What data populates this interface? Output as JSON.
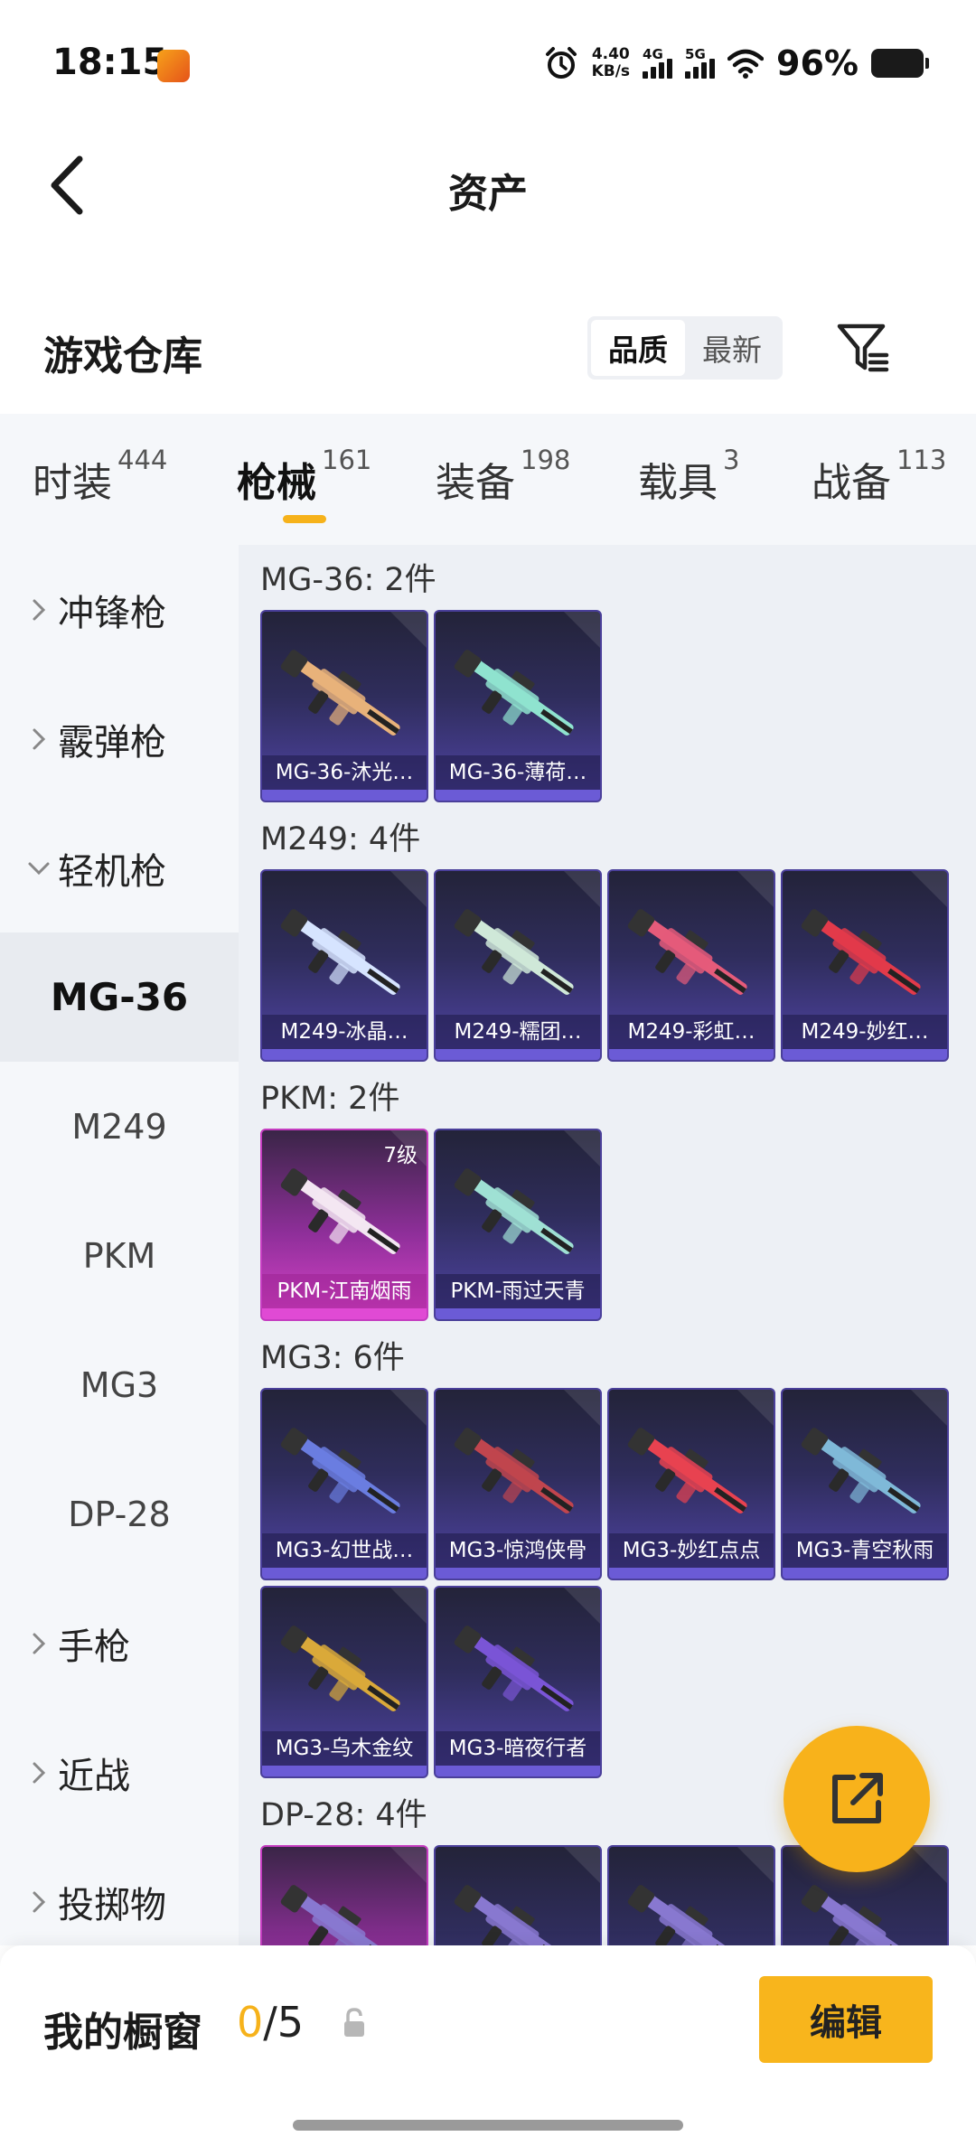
{
  "status": {
    "time": "18:15",
    "net_speed_value": "4.40",
    "net_speed_unit": "KB/s",
    "sim1": "4G",
    "sim2": "5G",
    "battery": "96%"
  },
  "header": {
    "title": "资产"
  },
  "warehouse": {
    "title": "游戏仓库",
    "sort_options": [
      "品质",
      "最新"
    ],
    "active_sort": "品质"
  },
  "tabs": [
    {
      "label": "时装",
      "count": "444"
    },
    {
      "label": "枪械",
      "count": "161"
    },
    {
      "label": "装备",
      "count": "198"
    },
    {
      "label": "载具",
      "count": "3"
    },
    {
      "label": "战备",
      "count": "113"
    }
  ],
  "active_tab": "枪械",
  "sidebar": {
    "groups": [
      {
        "label": "冲锋枪",
        "expanded": false
      },
      {
        "label": "霰弹枪",
        "expanded": false
      },
      {
        "label": "轻机枪",
        "expanded": true
      },
      {
        "label": "手枪",
        "expanded": false
      },
      {
        "label": "近战",
        "expanded": false
      },
      {
        "label": "投掷物",
        "expanded": false
      }
    ],
    "subitems": [
      "MG-36",
      "M249",
      "PKM",
      "MG3",
      "DP-28"
    ],
    "active_subitem": "MG-36"
  },
  "sections": [
    {
      "title": "MG-36: 2件",
      "items": [
        {
          "name": "MG-36-沐光…",
          "color": "#e8b27a"
        },
        {
          "name": "MG-36-薄荷…",
          "color": "#8fe3cf"
        }
      ]
    },
    {
      "title": "M249: 4件",
      "items": [
        {
          "name": "M249-冰晶…",
          "color": "#d6e4ff"
        },
        {
          "name": "M249-糯团…",
          "color": "#cfe8d8"
        },
        {
          "name": "M249-彩虹…",
          "color": "#e55b7a"
        },
        {
          "name": "M249-妙红…",
          "color": "#e23a4a"
        }
      ]
    },
    {
      "title": "PKM: 2件",
      "items": [
        {
          "name": "PKM-江南烟雨",
          "color": "#f3e6f2",
          "level": "7级",
          "rarity": "pink"
        },
        {
          "name": "PKM-雨过天青",
          "color": "#9fe0d4"
        }
      ]
    },
    {
      "title": "MG3: 6件",
      "items": [
        {
          "name": "MG3-幻世战…",
          "color": "#6a7de0"
        },
        {
          "name": "MG3-惊鸿侠骨",
          "color": "#c0454e"
        },
        {
          "name": "MG3-妙红点点",
          "color": "#e84250"
        },
        {
          "name": "MG3-青空秋雨",
          "color": "#7fb9d8"
        },
        {
          "name": "MG3-乌木金纹",
          "color": "#d9a93a"
        },
        {
          "name": "MG3-暗夜行者",
          "color": "#7a55d6"
        }
      ]
    },
    {
      "title": "DP-28: 4件",
      "items": []
    }
  ],
  "showcase": {
    "title": "我的橱窗",
    "current": "0",
    "total": "/5",
    "edit_label": "编辑"
  }
}
